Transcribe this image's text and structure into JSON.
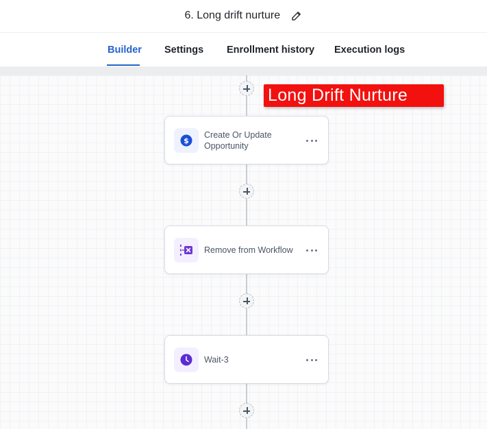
{
  "header": {
    "title": "6. Long drift nurture",
    "edit_icon": "pencil-icon"
  },
  "tabs": [
    {
      "label": "Builder",
      "active": true
    },
    {
      "label": "Settings",
      "active": false
    },
    {
      "label": "Enrollment history",
      "active": false
    },
    {
      "label": "Execution logs",
      "active": false
    }
  ],
  "banner": {
    "text": "Long Drift Nurture",
    "color": "#f2110f"
  },
  "nodes": [
    {
      "label": "Create Or Update Opportunity",
      "icon": "dollar-icon",
      "icon_color": "#1a4fd6"
    },
    {
      "label": "Remove from Workflow",
      "icon": "remove-from-workflow-icon",
      "icon_color": "#6d35d4"
    },
    {
      "label": "Wait-3",
      "icon": "clock-icon",
      "icon_color": "#5b2bd3"
    }
  ],
  "colors": {
    "accent": "#2563c9",
    "connector": "#c9ccd1"
  }
}
